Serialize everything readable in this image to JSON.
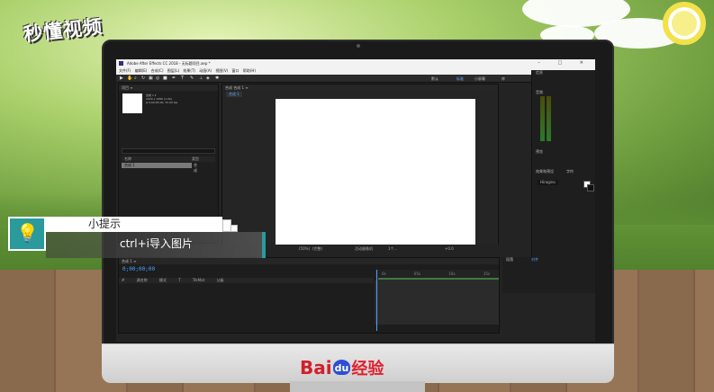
{
  "brand": {
    "logo_text": "秒懂视频",
    "footer_brand_bai": "Bai",
    "footer_brand_du": "du",
    "footer_brand_jingyan": "经验"
  },
  "app": {
    "title": "Adobe After Effects CC 2018 - 无标题项目.aep *",
    "menu": "文件(F)  编辑(E)  合成(C)  图层(L)  效果(T)  动画(A)  视图(V)  窗口  帮助(H)",
    "window_buttons": "–  □  ✕",
    "workspace_tabs": [
      "默认",
      "标准",
      "小屏幕",
      "库"
    ],
    "search_placeholder": "搜索帮助"
  },
  "project_panel": {
    "header": "项目 ≡",
    "comp_name": "合成 1 ▾",
    "comp_info": "1920 x 1080 (1.00)\nΔ 0;00;05;00, 25.00 fps",
    "column_name": "名称",
    "column_type": "类型",
    "item_name": "合成 1",
    "item_type": "合成"
  },
  "comp_panel": {
    "tab": "合成 合成 1 ≡",
    "subtab": "合成 1",
    "zoom": "(50%)",
    "quality": "(完整)",
    "camera": "活动摄像机",
    "views": "1个...",
    "exposure": "+0.0"
  },
  "timeline": {
    "tab": "合成 1 ≡",
    "timecode": "0;00;00;00",
    "layer_header": "# 源名称  模式  T TrkMat  父级",
    "ruler": [
      "0s",
      "05s",
      "10s",
      "15s"
    ]
  },
  "right_panels": {
    "info_tab": "信息",
    "audio_tab": "音频",
    "preview_tab": "预览",
    "effects_tab": "效果和预设",
    "character_tab": "字符",
    "font": "Hiragino",
    "paragraph_tab": "段落",
    "align_tab": "对齐"
  },
  "tip": {
    "title": "小提示",
    "body": "ctrl+i导入图片"
  }
}
